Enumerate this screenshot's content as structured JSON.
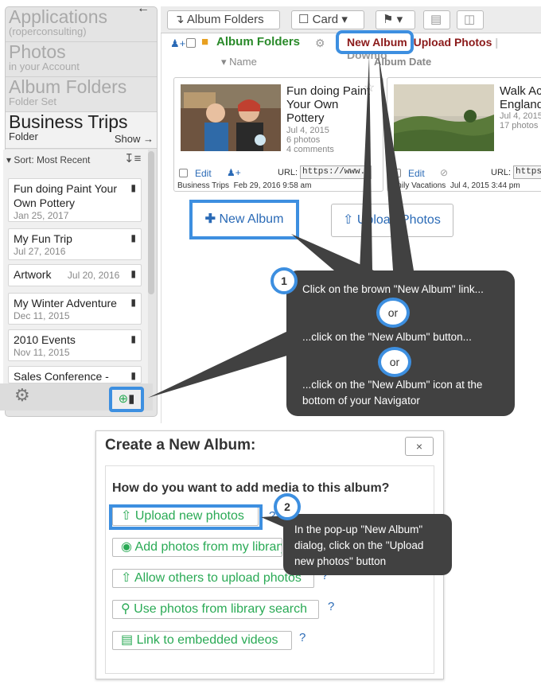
{
  "navigator": {
    "crumbs": [
      {
        "title": "Applications",
        "sub": "(roperconsulting)"
      },
      {
        "title": "Photos",
        "sub": "in your Account"
      },
      {
        "title": "Album Folders",
        "sub": "Folder Set"
      },
      {
        "title": "Business Trips",
        "sub": "Folder"
      }
    ],
    "show_label": "Show",
    "sort_label": "Sort: Most Recent",
    "items": [
      {
        "title": "Fun doing Paint Your Own Pottery",
        "date": "Jan 25, 2017"
      },
      {
        "title": "My Fun Trip",
        "date": "Jul 27, 2016"
      },
      {
        "title": "Artwork",
        "date": "Jul 20, 2016"
      },
      {
        "title": "My Winter Adventure",
        "date": "Dec 11, 2015"
      },
      {
        "title": "2010 Events",
        "date": "Nov 11, 2015"
      },
      {
        "title": "Sales Conference -",
        "date": ""
      }
    ]
  },
  "toolbar": {
    "album_folders": "Album Folders",
    "card": "Card"
  },
  "header": {
    "folder_label": "Album Folders",
    "new_album": "New Album",
    "upload_photos": "Upload Photos",
    "download": "Downlo",
    "col_name": "Name",
    "col_date": "Album Date"
  },
  "cards": [
    {
      "title": "Fun doing Paint Your Own Pottery",
      "date": "Jul 4, 2015",
      "photos": "6 photos",
      "comments": "4 comments",
      "edit": "Edit",
      "url_label": "URL:",
      "url": "https://www.keep",
      "folder": "Business Trips",
      "stamp": "Feb 29, 2016 9:58 am"
    },
    {
      "title": "Walk Ac England",
      "date": "Jul 4, 2015",
      "photos": "17 photos",
      "comments": "",
      "edit": "Edit",
      "url_label": "URL:",
      "url": "https://",
      "folder": "amily Vacations",
      "stamp": "Jul 4, 2015 3:44 pm"
    }
  ],
  "buttons": {
    "new_album": "New Album",
    "upload_photos": "Upload Photos"
  },
  "tip1": {
    "line1": "Click on the brown \"New Album\" link...",
    "or": "or",
    "line2": "...click on the \"New Album\" button...",
    "line3a": "...click on the \"New Album\" icon at the",
    "line3b": "bottom of your Navigator",
    "step": "1"
  },
  "dialog": {
    "title": "Create a New Album:",
    "close": "×",
    "question": "How do you want to add media to this album?",
    "options": [
      "Upload new photos",
      "Add photos from my library",
      "Allow others to upload photos",
      "Use photos from library search",
      "Link to embedded videos"
    ],
    "help": "?"
  },
  "tip2": {
    "step": "2",
    "text": "In the pop-up \"New Album\" dialog, click on the \"Upload new photos\" button"
  },
  "colors": {
    "accent": "#3d8fe0",
    "link_brown": "#8b1a1a",
    "green": "#2aaa55",
    "tooltip": "#414141"
  }
}
